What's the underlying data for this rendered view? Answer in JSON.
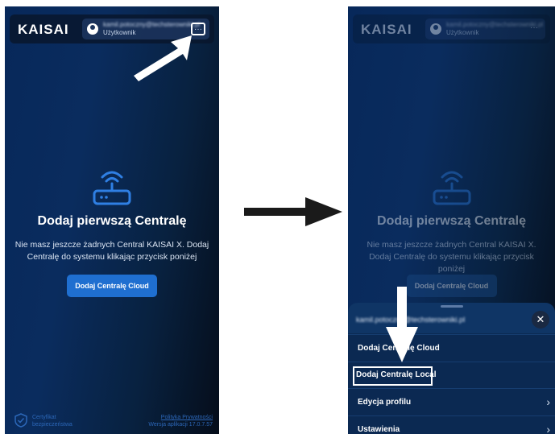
{
  "left_screen": {
    "header": {
      "logo": "KAISAI",
      "user_email": "kamil.potoczny@techsterowniki.pl",
      "user_role": "Użytkownik",
      "more_label": "···"
    },
    "empty_state": {
      "title": "Dodaj pierwszą Centralę",
      "description": "Nie masz jeszcze żadnych Central KAISAI X. Dodaj Centralę do systemu klikając przycisk poniżej",
      "button_label": "Dodaj Centralę Cloud"
    },
    "footer": {
      "certificate_label": "Certyfikat bezpieczeństwa",
      "privacy_label": "Polityka Prywatności",
      "version_label": "Wersja aplikacji 17.0.7.57"
    }
  },
  "right_screen": {
    "header": {
      "logo": "KAISAI",
      "user_email": "kamil.potoczny@techsterowniki.pl",
      "user_role": "Użytkownik",
      "more_label": "···"
    },
    "empty_state": {
      "title": "Dodaj pierwszą Centralę",
      "description": "Nie masz jeszcze żadnych Central KAISAI X. Dodaj Centralę do systemu klikając przycisk poniżej",
      "button_label": "Dodaj Centralę Cloud"
    },
    "menu": {
      "email": "kamil.potoczny@techsterowniki.pl",
      "close_label": "✕",
      "items": [
        {
          "label": "Dodaj Centralę Cloud"
        },
        {
          "label": "Dodaj Centralę Local"
        },
        {
          "label": "Edycja profilu"
        },
        {
          "label": "Ustawienia"
        }
      ]
    }
  },
  "colors": {
    "background_start": "#07285a",
    "background_end": "#050d1a",
    "accent_button": "#1f6fd0",
    "link_blue": "#2c67b8",
    "menu_background": "#0b2952"
  }
}
